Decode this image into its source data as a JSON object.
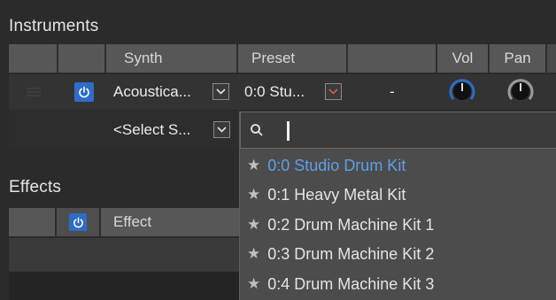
{
  "instruments": {
    "title": "Instruments",
    "columns": [
      "Synth",
      "Preset",
      "Vol",
      "Pan"
    ],
    "row1": {
      "synth": "Acoustica...",
      "preset": "0:0 Stu...",
      "value": "-"
    },
    "row2": {
      "synth": "<Select S..."
    }
  },
  "effects": {
    "title": "Effects",
    "column": "Effect"
  },
  "dropdown": {
    "search_value": "",
    "items": [
      {
        "label": "0:0 Studio Drum Kit",
        "selected": true
      },
      {
        "label": "0:1 Heavy Metal Kit",
        "selected": false
      },
      {
        "label": "0:2 Drum Machine Kit 1",
        "selected": false
      },
      {
        "label": "0:3 Drum Machine Kit 2",
        "selected": false
      },
      {
        "label": "0:4 Drum Machine Kit 3",
        "selected": false
      }
    ]
  },
  "colors": {
    "accent_blue": "#2f6cc7",
    "selected_text": "#5aa0e8",
    "preset_chevron": "#e0584a"
  }
}
